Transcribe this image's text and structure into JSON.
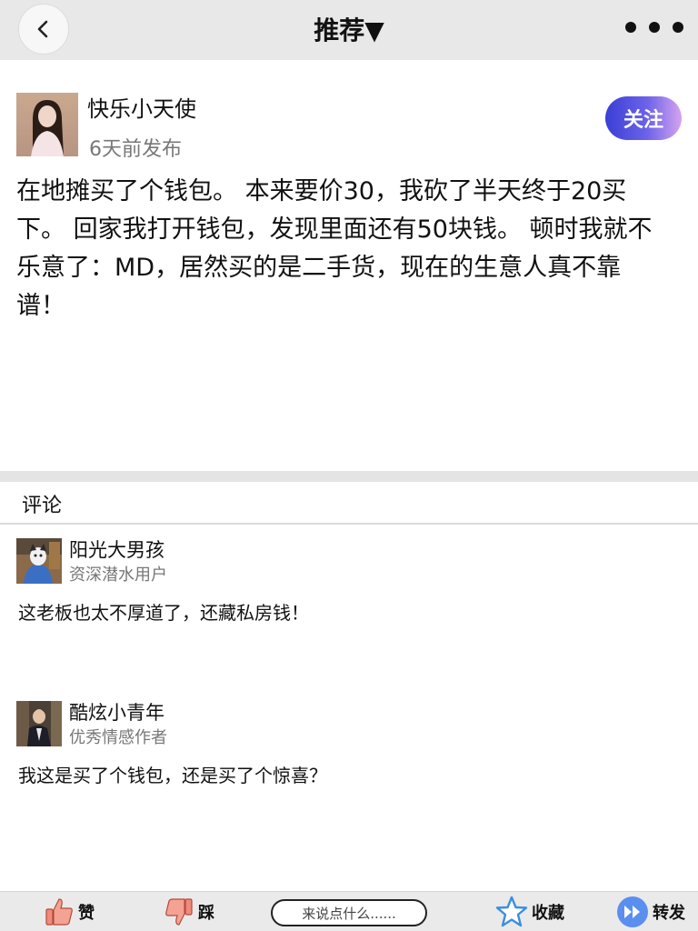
{
  "header": {
    "title": "推荐▼",
    "back_icon": "chevron-left-icon",
    "more_icon": "more-dots-icon"
  },
  "post": {
    "author_name": "快乐小天使",
    "time": "6天前发布",
    "follow_label": "关注",
    "body": "在地摊买了个钱包。 本来要价30，我砍了半天终于20买下。 回家我打开钱包，发现里面还有50块钱。 顿时我就不乐意了：MD，居然买的是二手货，现在的生意人真不靠谱！"
  },
  "comments_section": {
    "title": "评论",
    "items": [
      {
        "name": "阳光大男孩",
        "role": "资深潜水用户",
        "text": "这老板也太不厚道了，还藏私房钱！"
      },
      {
        "name": "酷炫小青年",
        "role": "优秀情感作者",
        "text": "我这是买了个钱包，还是买了个惊喜？"
      }
    ]
  },
  "bottom_bar": {
    "like_label": "赞",
    "dislike_label": "踩",
    "comment_placeholder": "来说点什么......",
    "favorite_label": "收藏",
    "share_label": "转发"
  },
  "colors": {
    "header_bg": "#e8e8e8",
    "follow_gradient_start": "#3a3fd6",
    "follow_gradient_end": "#d5a3f0",
    "like_icon": "#f08a7a",
    "favorite_icon": "#3a8fe0",
    "share_icon": "#5b8fef"
  }
}
